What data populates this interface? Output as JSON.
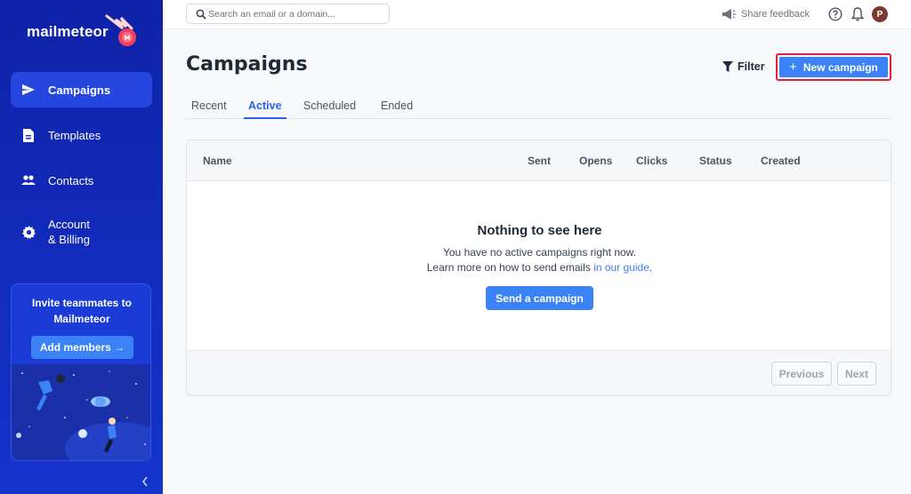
{
  "app": {
    "name": "mailmeteor"
  },
  "sidebar": {
    "items": [
      {
        "label": "Campaigns",
        "icon": "send-icon",
        "active": true
      },
      {
        "label": "Templates",
        "icon": "document-icon",
        "active": false
      },
      {
        "label": "Contacts",
        "icon": "people-icon",
        "active": false
      },
      {
        "label": "Account\n& Billing",
        "icon": "gear-icon",
        "active": false
      }
    ],
    "invite": {
      "title": "Invite teammates to Mailmeteor",
      "button": "Add members →"
    }
  },
  "topbar": {
    "search_placeholder": "Search an email or a domain...",
    "feedback_label": "Share feedback",
    "avatar_initial": "P"
  },
  "main": {
    "title": "Campaigns",
    "filter_label": "Filter",
    "new_campaign_label": "New campaign",
    "tabs": [
      {
        "label": "Recent",
        "active": false
      },
      {
        "label": "Active",
        "active": true
      },
      {
        "label": "Scheduled",
        "active": false
      },
      {
        "label": "Ended",
        "active": false
      }
    ],
    "table": {
      "columns": [
        "Name",
        "Sent",
        "Opens",
        "Clicks",
        "Status",
        "Created"
      ],
      "empty_title": "Nothing to see here",
      "empty_line1": "You have no active campaigns right now.",
      "empty_line2_prefix": "Learn more on how to send emails ",
      "empty_link": "in our guide",
      "empty_line2_suffix": ".",
      "send_button": "Send a campaign",
      "prev_label": "Previous",
      "next_label": "Next"
    }
  },
  "colors": {
    "sidebar": "#1534cc",
    "accent": "#3b82f6",
    "highlight_border": "#e11d48"
  }
}
